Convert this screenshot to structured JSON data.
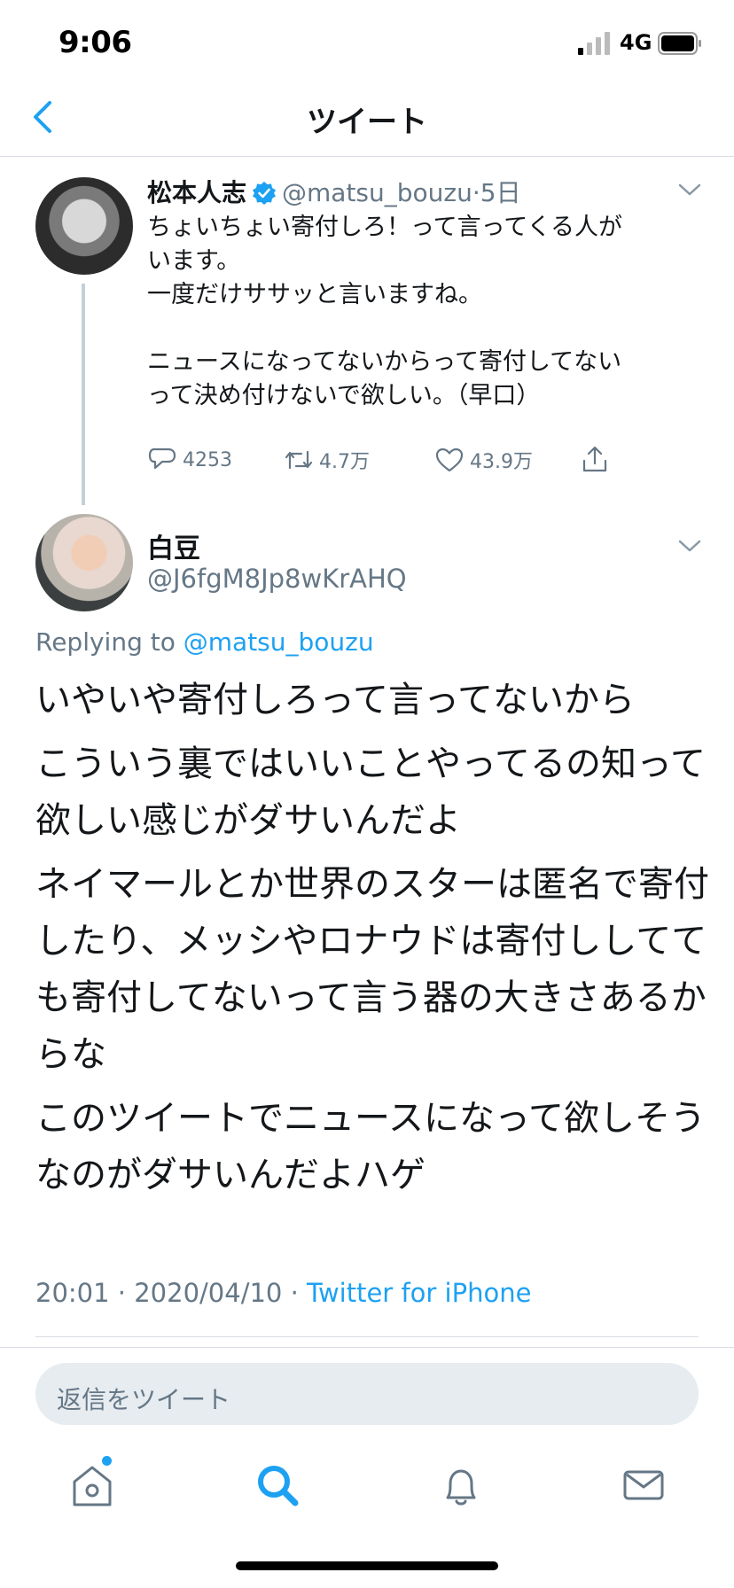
{
  "status_bar": {
    "time": "9:06",
    "network": "4G"
  },
  "nav": {
    "title": "ツイート"
  },
  "parent_tweet": {
    "name": "松本人志",
    "handle": "@matsu_bouzu",
    "time": "5日",
    "body_lines": [
      "ちょいちょい寄付しろ！って言ってくる人が",
      "います。",
      "一度だけササッと言いますね。",
      "",
      "ニュースになってないからって寄付してない",
      "って決め付けないで欲しい。（早口）"
    ],
    "replies": "4253",
    "retweets": "4.7万",
    "likes": "43.9万"
  },
  "reply_tweet": {
    "name": "白豆",
    "handle": "@J6fgM8Jp8wKrAHQ",
    "replying_prefix": "Replying to ",
    "replying_handle": "@matsu_bouzu",
    "paragraphs": [
      "いやいや寄付しろって言ってないから",
      "こういう裏ではいいことやってるの知って欲しい感じがダサいんだよ",
      "ネイマールとか世界のスターは匿名で寄付したり、メッシやロナウドは寄付ししてても寄付してないって言う器の大きさあるからな",
      "このツイートでニュースになって欲しそうなのがダサいんだよハゲ"
    ],
    "meta_time": "20:01 · 2020/04/10 · ",
    "meta_source": "Twitter for iPhone"
  },
  "composer": {
    "placeholder": "返信をツイート"
  },
  "tabs": [
    "home-icon",
    "search-icon",
    "bell-icon",
    "mail-icon"
  ],
  "colors": {
    "accent": "#1da1f2",
    "muted": "#657786",
    "text": "#14171a",
    "divider": "#d8dee3"
  }
}
